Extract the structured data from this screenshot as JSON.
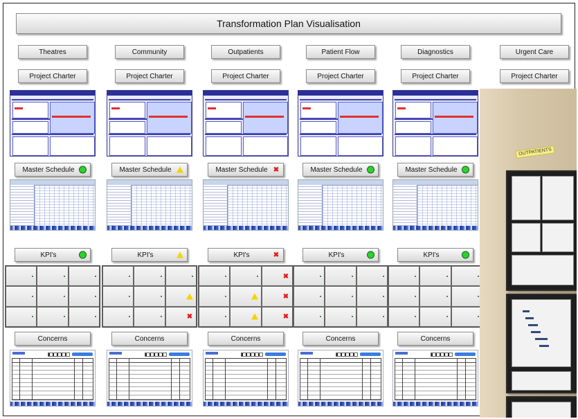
{
  "title": "Transformation Plan Visualisation",
  "charter_label": "Project Charter",
  "master_label": "Master Schedule",
  "kpi_label": "KPI's",
  "concerns_label": "Concerns",
  "photo_label": "OUTPATIENTS",
  "status_colors": {
    "green": "#2fd12f",
    "amber": "#f4d400",
    "red": "#e21b1b"
  },
  "columns": [
    {
      "name": "Theatres",
      "master_status": "green",
      "kpi_status": "green",
      "kpis": [
        "green",
        "green",
        "green",
        "green",
        "green",
        "green",
        "green",
        "green",
        "green"
      ]
    },
    {
      "name": "Community",
      "master_status": "amber",
      "kpi_status": "amber",
      "kpis": [
        "green",
        "green",
        "green",
        "green",
        "green",
        "amber",
        "green",
        "green",
        "red"
      ]
    },
    {
      "name": "Outpatients",
      "master_status": "red",
      "kpi_status": "red",
      "kpis": [
        "green",
        "green",
        "red",
        "green",
        "amber",
        "red",
        "green",
        "amber",
        "red"
      ]
    },
    {
      "name": "Patient Flow",
      "master_status": "green",
      "kpi_status": "green",
      "kpis": [
        "green",
        "green",
        "green",
        "green",
        "green",
        "green",
        "green",
        "green",
        "green"
      ]
    },
    {
      "name": "Diagnostics",
      "master_status": "green",
      "kpi_status": "green",
      "kpis": [
        "green",
        "green",
        "green",
        "green",
        "green",
        "green",
        "green",
        "green",
        "green"
      ]
    },
    {
      "name": "Urgent Care"
    }
  ]
}
